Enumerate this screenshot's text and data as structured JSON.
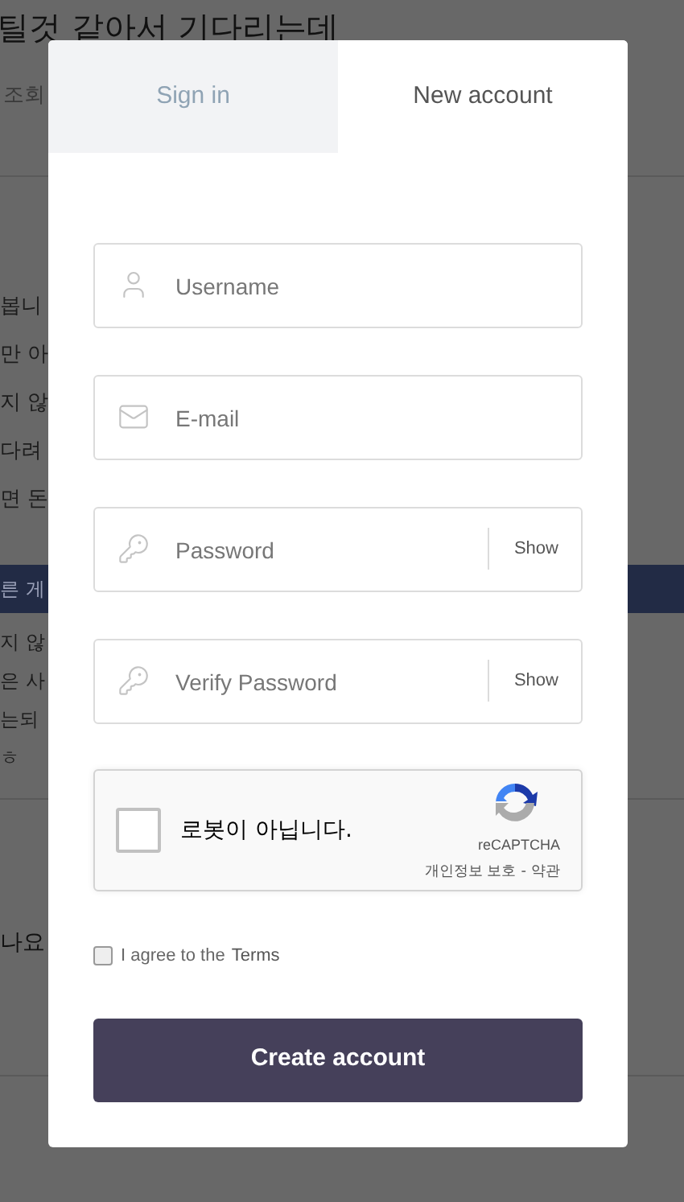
{
  "background": {
    "title": "틸것 같아서 기다리는데",
    "meta": "조회",
    "lines_1": [
      "봅니",
      "만 아",
      "지 않",
      "다려",
      "면 돈"
    ],
    "banner": "른 게",
    "lines_2": [
      "지 않",
      "은 사",
      "는되",
      "ㅎ"
    ],
    "heading_2": "나요"
  },
  "modal": {
    "tabs": [
      {
        "label": "Sign in",
        "selected": false
      },
      {
        "label": "New account",
        "selected": true
      }
    ],
    "fields": [
      {
        "kind": "username",
        "placeholder": "Username"
      },
      {
        "kind": "email",
        "placeholder": "E-mail"
      },
      {
        "kind": "password",
        "placeholder": "Password",
        "toggle": "Show"
      },
      {
        "kind": "password",
        "placeholder": "Verify Password",
        "toggle": "Show"
      }
    ],
    "captcha": {
      "checked": false,
      "label": "로봇이 아닙니다.",
      "brand": "reCAPTCHA",
      "privacy": "개인정보 보호",
      "separator": "-",
      "terms": "약관"
    },
    "agree": {
      "checked": false,
      "text": "I agree to the",
      "link": "Terms"
    },
    "submit": "Create account"
  }
}
